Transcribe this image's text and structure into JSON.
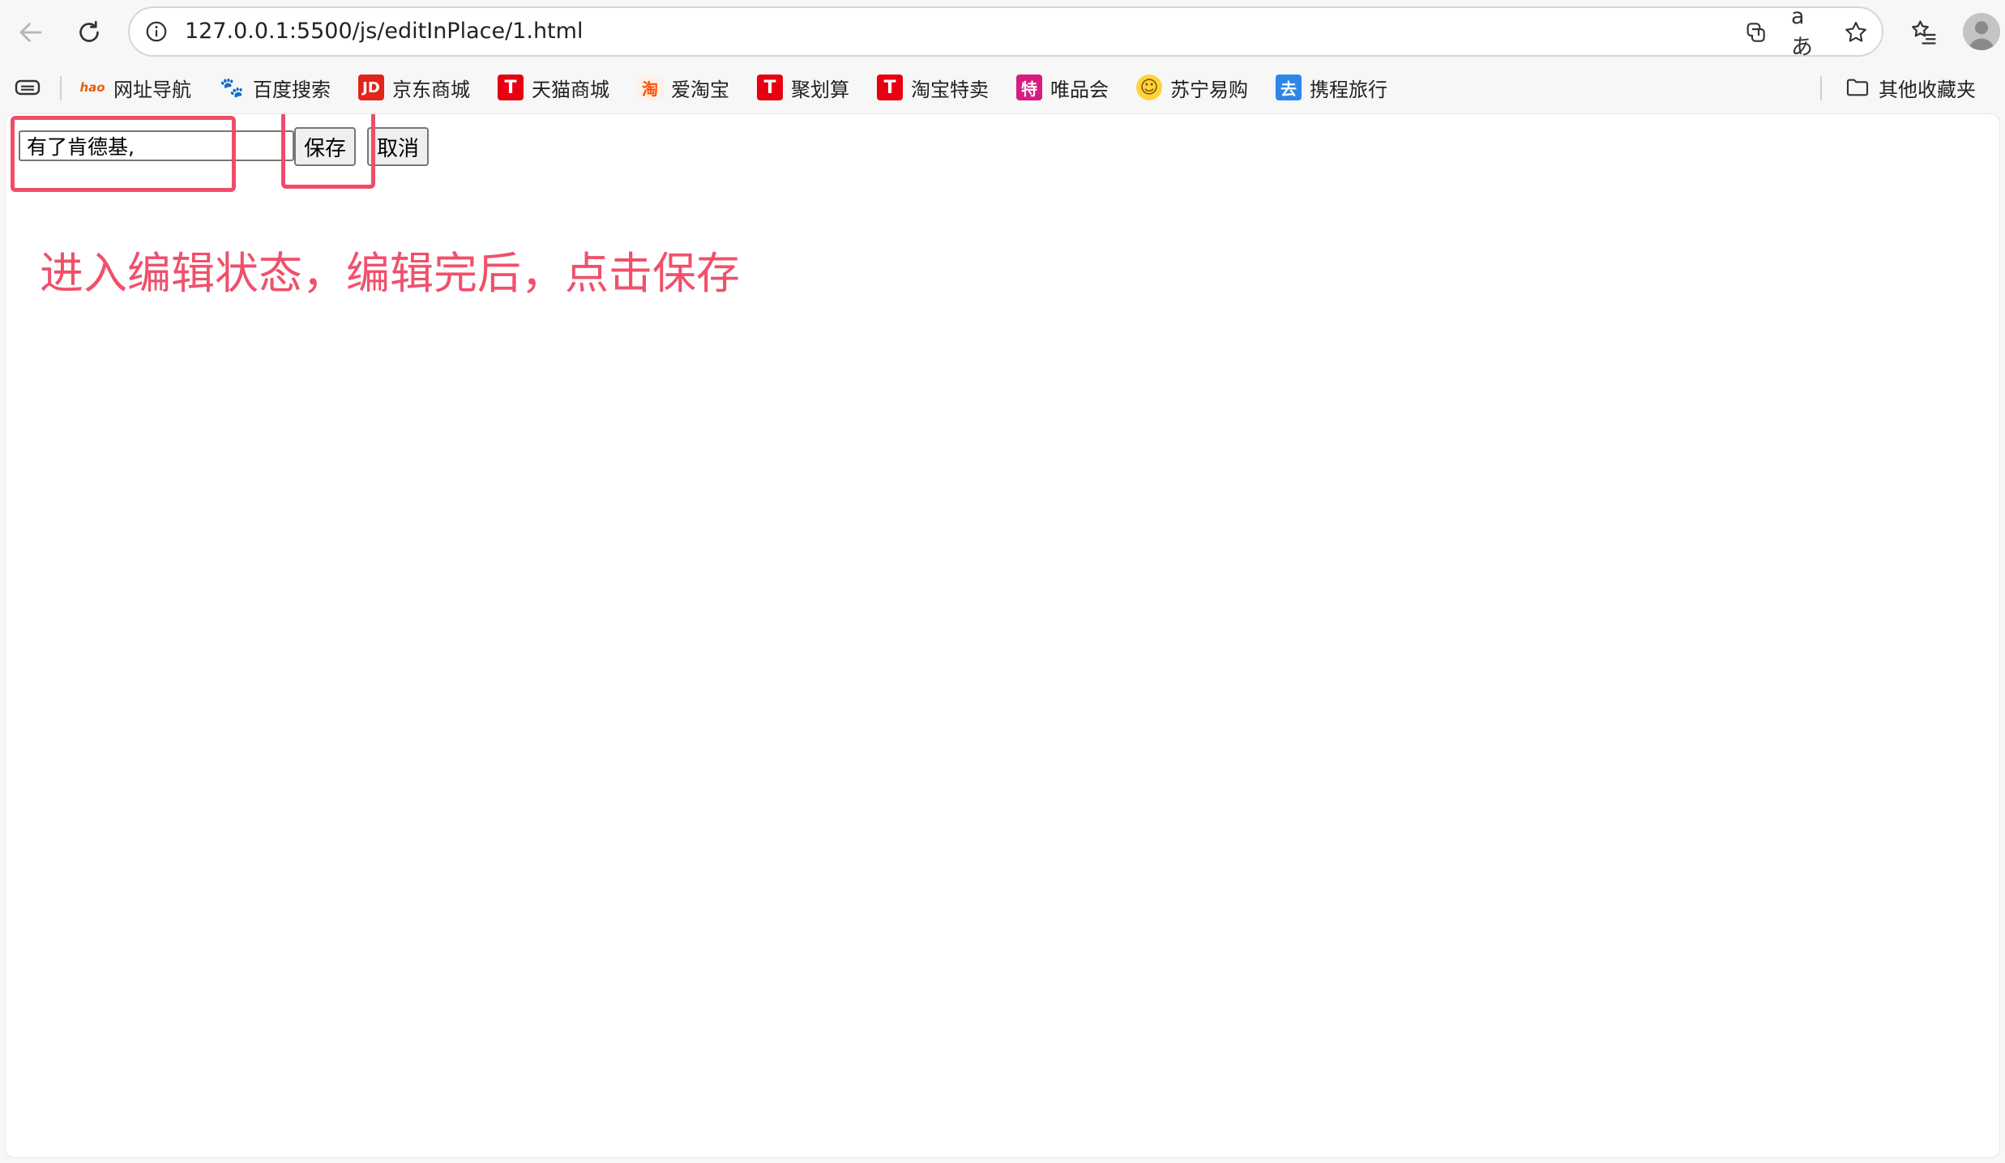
{
  "browser": {
    "url": "127.0.0.1:5500/js/editInPlace/1.html",
    "translate_label": "aあ"
  },
  "bookmarks": {
    "items": [
      {
        "label": "网址导航",
        "icon": "hao123-icon",
        "glyph": "hao",
        "color": "#e85d12"
      },
      {
        "label": "百度搜索",
        "icon": "baidu-paw-icon",
        "glyph": "🐾",
        "color": "#2932e1"
      },
      {
        "label": "京东商城",
        "icon": "jd-icon",
        "glyph": "JD",
        "color": "#e1251b"
      },
      {
        "label": "天猫商城",
        "icon": "tmall-icon",
        "glyph": "T",
        "color": "#e60012"
      },
      {
        "label": "爱淘宝",
        "icon": "taobao-icon",
        "glyph": "淘",
        "color": "#ff5000"
      },
      {
        "label": "聚划算",
        "icon": "juhuasuan-icon",
        "glyph": "T",
        "color": "#e60012"
      },
      {
        "label": "淘宝特卖",
        "icon": "taobao-temai-icon",
        "glyph": "T",
        "color": "#e60012"
      },
      {
        "label": "唯品会",
        "icon": "vip-icon",
        "glyph": "特",
        "color": "#d81b82"
      },
      {
        "label": "苏宁易购",
        "icon": "suning-icon",
        "glyph": "☺",
        "color": "#f5b800"
      },
      {
        "label": "携程旅行",
        "icon": "ctrip-icon",
        "glyph": "去",
        "color": "#2e87e8"
      }
    ],
    "other_folder": "其他收藏夹"
  },
  "page": {
    "input_value": "有了肯德基,",
    "save_label": "保存",
    "cancel_label": "取消",
    "annotation": "进入编辑状态，编辑完后，点击保存",
    "highlight_color": "#ef4d6a"
  }
}
